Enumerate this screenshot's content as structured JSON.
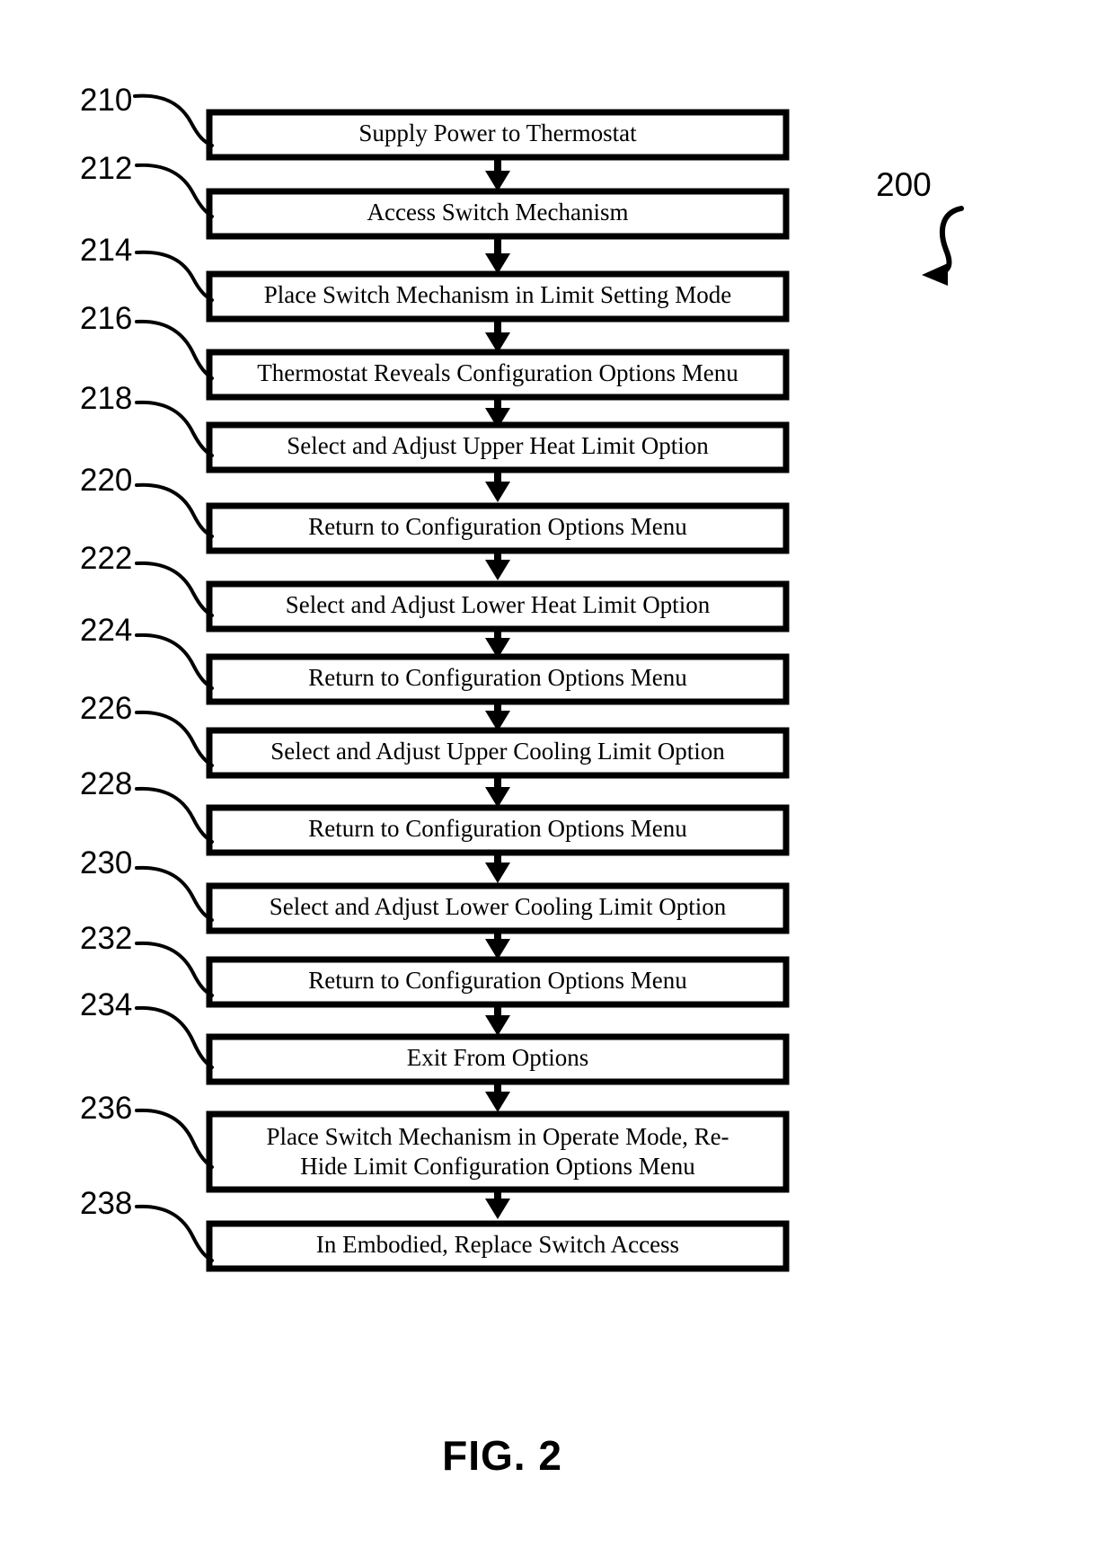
{
  "figure": {
    "caption": "FIG. 2",
    "diagram_ref": "200"
  },
  "chart_data": {
    "type": "diagram",
    "title": "FIG. 2",
    "diagram_type": "flowchart",
    "orientation": "vertical-top-to-bottom",
    "overall_reference": "200",
    "nodes": [
      {
        "ref": "210",
        "label": "Supply Power to Thermostat"
      },
      {
        "ref": "212",
        "label": "Access Switch Mechanism"
      },
      {
        "ref": "214",
        "label": "Place Switch Mechanism in Limit Setting Mode"
      },
      {
        "ref": "216",
        "label": "Thermostat Reveals Configuration Options Menu"
      },
      {
        "ref": "218",
        "label": "Select and Adjust Upper Heat Limit Option"
      },
      {
        "ref": "220",
        "label": "Return to Configuration Options Menu"
      },
      {
        "ref": "222",
        "label": "Select and Adjust  Lower Heat Limit Option"
      },
      {
        "ref": "224",
        "label": "Return to Configuration Options Menu"
      },
      {
        "ref": "226",
        "label": "Select and Adjust Upper Cooling Limit Option"
      },
      {
        "ref": "228",
        "label": "Return to Configuration Options Menu"
      },
      {
        "ref": "230",
        "label": "Select and Adjust Lower Cooling Limit Option"
      },
      {
        "ref": "232",
        "label": "Return to Configuration Options Menu"
      },
      {
        "ref": "234",
        "label": "Exit From Options"
      },
      {
        "ref": "236",
        "label": "Place Switch Mechanism in Operate Mode, Re-Hide Limit Configuration Options Menu",
        "label_line1": "Place Switch Mechanism in Operate Mode, Re-",
        "label_line2": "Hide Limit Configuration Options Menu"
      },
      {
        "ref": "238",
        "label": "In Embodied, Replace Switch Access"
      }
    ],
    "edges": [
      {
        "from": "210",
        "to": "212"
      },
      {
        "from": "212",
        "to": "214"
      },
      {
        "from": "214",
        "to": "216"
      },
      {
        "from": "216",
        "to": "218"
      },
      {
        "from": "218",
        "to": "220"
      },
      {
        "from": "220",
        "to": "222"
      },
      {
        "from": "222",
        "to": "224"
      },
      {
        "from": "224",
        "to": "226"
      },
      {
        "from": "226",
        "to": "228"
      },
      {
        "from": "228",
        "to": "230"
      },
      {
        "from": "230",
        "to": "232"
      },
      {
        "from": "232",
        "to": "234"
      },
      {
        "from": "234",
        "to": "236"
      },
      {
        "from": "236",
        "to": "238"
      }
    ],
    "colors": {
      "stroke": "#000000",
      "fill": "#ffffff",
      "background": "#ffffff"
    }
  },
  "nodes": {
    "n210": {
      "ref": "210",
      "label": "Supply Power to Thermostat"
    },
    "n212": {
      "ref": "212",
      "label": "Access Switch Mechanism"
    },
    "n214": {
      "ref": "214",
      "label": "Place Switch Mechanism in Limit Setting Mode"
    },
    "n216": {
      "ref": "216",
      "label": "Thermostat Reveals Configuration Options Menu"
    },
    "n218": {
      "ref": "218",
      "label": "Select and Adjust Upper Heat Limit Option"
    },
    "n220": {
      "ref": "220",
      "label": "Return to Configuration Options Menu"
    },
    "n222": {
      "ref": "222",
      "label": "Select and Adjust  Lower Heat Limit Option"
    },
    "n224": {
      "ref": "224",
      "label": "Return to Configuration Options Menu"
    },
    "n226": {
      "ref": "226",
      "label": "Select and Adjust Upper Cooling Limit Option"
    },
    "n228": {
      "ref": "228",
      "label": "Return to Configuration Options Menu"
    },
    "n230": {
      "ref": "230",
      "label": "Select and Adjust Lower Cooling Limit Option"
    },
    "n232": {
      "ref": "232",
      "label": "Return to Configuration Options Menu"
    },
    "n234": {
      "ref": "234",
      "label": "Exit From Options"
    },
    "n236": {
      "ref": "236",
      "label_line1": "Place Switch Mechanism in Operate Mode, Re-",
      "label_line2": "Hide Limit Configuration Options Menu"
    },
    "n238": {
      "ref": "238",
      "label": "In Embodied, Replace Switch Access"
    }
  }
}
